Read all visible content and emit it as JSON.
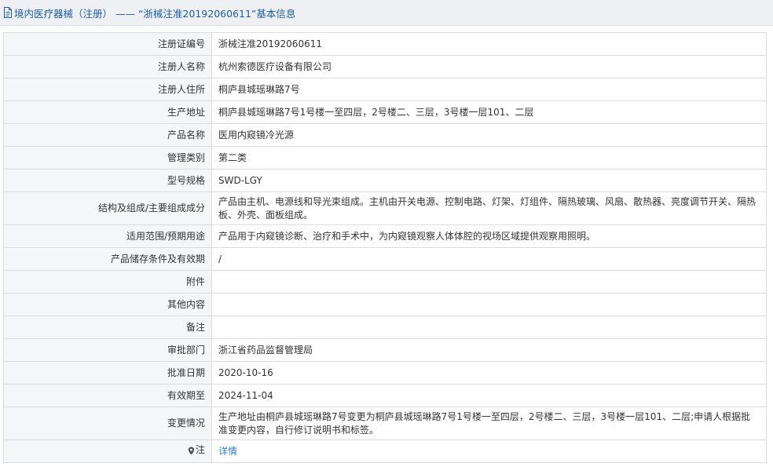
{
  "header": {
    "title": "境内医疗器械（注册） —— “浙械注准20192060611”基本信息"
  },
  "rows": [
    {
      "label": "注册证编号",
      "value": "浙械注准20192060611"
    },
    {
      "label": "注册人名称",
      "value": "杭州索德医疗设备有限公司"
    },
    {
      "label": "注册人住所",
      "value": "桐庐县城瑶琳路7号"
    },
    {
      "label": "生产地址",
      "value": "桐庐县城瑶琳路7号1号楼一至四层，2号楼二、三层，3号楼一层101、二层"
    },
    {
      "label": "产品名称",
      "value": "医用内窥镜冷光源"
    },
    {
      "label": "管理类别",
      "value": "第二类"
    },
    {
      "label": "型号规格",
      "value": "SWD-LGY"
    },
    {
      "label": "结构及组成/主要组成成分",
      "value": "产品由主机、电源线和导光束组成。主机由开关电源、控制电路、灯架、灯组件、隔热玻璃、风扇、散热器、亮度调节开关、隔热板、外壳、面板组成。"
    },
    {
      "label": "适用范围/预期用途",
      "value": "产品用于内窥镜诊断、治疗和手术中，为内窥镜观察人体体腔的视场区域提供观察用照明。"
    },
    {
      "label": "产品储存条件及有效期",
      "value": "/"
    },
    {
      "label": "附件",
      "value": ""
    },
    {
      "label": "其他内容",
      "value": ""
    },
    {
      "label": "备注",
      "value": ""
    },
    {
      "label": "审批部门",
      "value": "浙江省药品监督管理局"
    },
    {
      "label": "批准日期",
      "value": "2020-10-16"
    },
    {
      "label": "有效期至",
      "value": "2024-11-04"
    },
    {
      "label": "变更情况",
      "value": "生产地址由桐庐县城瑶琳路7号变更为桐庐县城瑶琳路7号1号楼一至四层，2号楼二、三层，3号楼一层101、二层;申请人根据批准变更内容，自行修订说明书和标签。"
    },
    {
      "label": "注",
      "value": "详情"
    }
  ],
  "colors": {
    "title": "#1c5eaa",
    "link": "#2f7cd1",
    "label_bg": "#f5f6f8",
    "border": "#dcdcdc"
  },
  "icons": {
    "header": "document-icon",
    "note": "pin-icon"
  }
}
